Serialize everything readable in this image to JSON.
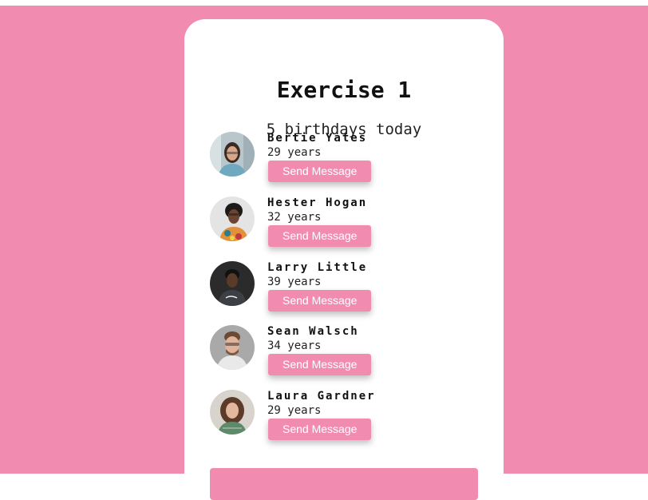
{
  "page": {
    "background_color": "#f18cb0",
    "card_color": "#ffffff"
  },
  "header": {
    "title": "Exercise 1",
    "subtitle": "5 birthdays today"
  },
  "people": [
    {
      "name": "Bertie Yates",
      "age": "29 years",
      "button_label": "Send Message",
      "avatar_icon": "portrait-woman-glasses"
    },
    {
      "name": "Hester Hogan",
      "age": "32 years",
      "button_label": "Send Message",
      "avatar_icon": "portrait-woman-braids"
    },
    {
      "name": "Larry Little",
      "age": "39 years",
      "button_label": "Send Message",
      "avatar_icon": "portrait-man-dark-background"
    },
    {
      "name": "Sean Walsch",
      "age": "34 years",
      "button_label": "Send Message",
      "avatar_icon": "portrait-man-glasses-beard"
    },
    {
      "name": "Laura Gardner",
      "age": "29 years",
      "button_label": "Send Message",
      "avatar_icon": "portrait-woman-curly-hair"
    }
  ]
}
